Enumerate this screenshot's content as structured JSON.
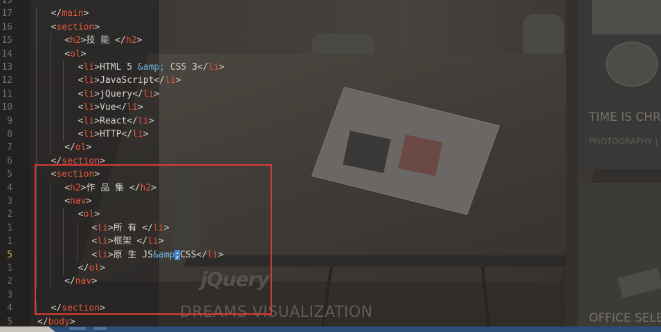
{
  "background": {
    "watermark_logo": "jQuery",
    "center_title": "DREAMS VISUALIZATION",
    "tile_1": {
      "title": "TIME IS CHRO",
      "subtitle": "PHOTOGRAPHY |"
    },
    "tile_2": {
      "title": "OFFICE SELEC"
    }
  },
  "editor": {
    "current_line_number": "5",
    "lines": [
      {
        "num": "19",
        "indent": 0,
        "parts": []
      },
      {
        "num": "17",
        "indent": 1,
        "parts": [
          [
            "p",
            "</"
          ],
          [
            "t",
            "main"
          ],
          [
            "p",
            ">"
          ]
        ]
      },
      {
        "num": "16",
        "indent": 1,
        "parts": [
          [
            "p",
            "<"
          ],
          [
            "t",
            "section"
          ],
          [
            "p",
            ">"
          ]
        ]
      },
      {
        "num": "15",
        "indent": 2,
        "parts": [
          [
            "p",
            "<"
          ],
          [
            "t",
            "h2"
          ],
          [
            "p",
            ">"
          ],
          [
            "p",
            "技 能 "
          ],
          [
            "p",
            "</"
          ],
          [
            "t",
            "h2"
          ],
          [
            "p",
            ">"
          ]
        ]
      },
      {
        "num": "14",
        "indent": 2,
        "parts": [
          [
            "p",
            "<"
          ],
          [
            "t",
            "ol"
          ],
          [
            "p",
            ">"
          ]
        ]
      },
      {
        "num": "13",
        "indent": 3,
        "parts": [
          [
            "p",
            "<"
          ],
          [
            "t",
            "li"
          ],
          [
            "p",
            ">"
          ],
          [
            "p",
            "HTML 5 "
          ],
          [
            "e",
            "&amp;"
          ],
          [
            "p",
            " CSS 3"
          ],
          [
            "p",
            "</"
          ],
          [
            "t",
            "li"
          ],
          [
            "p",
            ">"
          ]
        ]
      },
      {
        "num": "12",
        "indent": 3,
        "parts": [
          [
            "p",
            "<"
          ],
          [
            "t",
            "li"
          ],
          [
            "p",
            ">"
          ],
          [
            "p",
            "JavaScript"
          ],
          [
            "p",
            "</"
          ],
          [
            "t",
            "li"
          ],
          [
            "p",
            ">"
          ]
        ]
      },
      {
        "num": "11",
        "indent": 3,
        "parts": [
          [
            "p",
            "<"
          ],
          [
            "t",
            "li"
          ],
          [
            "p",
            ">"
          ],
          [
            "p",
            "jQuery"
          ],
          [
            "p",
            "</"
          ],
          [
            "t",
            "li"
          ],
          [
            "p",
            ">"
          ]
        ]
      },
      {
        "num": "10",
        "indent": 3,
        "parts": [
          [
            "p",
            "<"
          ],
          [
            "t",
            "li"
          ],
          [
            "p",
            ">"
          ],
          [
            "p",
            "Vue"
          ],
          [
            "p",
            "</"
          ],
          [
            "t",
            "li"
          ],
          [
            "p",
            ">"
          ]
        ]
      },
      {
        "num": "9",
        "indent": 3,
        "parts": [
          [
            "p",
            "<"
          ],
          [
            "t",
            "li"
          ],
          [
            "p",
            ">"
          ],
          [
            "p",
            "React"
          ],
          [
            "p",
            "</"
          ],
          [
            "t",
            "li"
          ],
          [
            "p",
            ">"
          ]
        ]
      },
      {
        "num": "8",
        "indent": 3,
        "parts": [
          [
            "p",
            "<"
          ],
          [
            "t",
            "li"
          ],
          [
            "p",
            ">"
          ],
          [
            "p",
            "HTTP"
          ],
          [
            "p",
            "</"
          ],
          [
            "t",
            "li"
          ],
          [
            "p",
            ">"
          ]
        ]
      },
      {
        "num": "7",
        "indent": 2,
        "parts": [
          [
            "p",
            "</"
          ],
          [
            "t",
            "ol"
          ],
          [
            "p",
            ">"
          ]
        ]
      },
      {
        "num": "6",
        "indent": 1,
        "parts": [
          [
            "p",
            "</"
          ],
          [
            "t",
            "section"
          ],
          [
            "p",
            ">"
          ]
        ]
      },
      {
        "num": "5",
        "indent": 1,
        "parts": [
          [
            "p",
            "<"
          ],
          [
            "t",
            "section"
          ],
          [
            "p",
            ">"
          ]
        ]
      },
      {
        "num": "4",
        "indent": 2,
        "parts": [
          [
            "p",
            "<"
          ],
          [
            "t",
            "h2"
          ],
          [
            "p",
            ">"
          ],
          [
            "p",
            "作 品 集 "
          ],
          [
            "p",
            "</"
          ],
          [
            "t",
            "h2"
          ],
          [
            "p",
            ">"
          ]
        ]
      },
      {
        "num": "3",
        "indent": 2,
        "parts": [
          [
            "p",
            "<"
          ],
          [
            "t",
            "nav"
          ],
          [
            "p",
            ">"
          ]
        ]
      },
      {
        "num": "2",
        "indent": 3,
        "parts": [
          [
            "p",
            "<"
          ],
          [
            "t",
            "ol"
          ],
          [
            "p",
            ">"
          ]
        ]
      },
      {
        "num": "1",
        "indent": 4,
        "parts": [
          [
            "p",
            "<"
          ],
          [
            "t",
            "li"
          ],
          [
            "p",
            ">"
          ],
          [
            "p",
            "所 有 "
          ],
          [
            "p",
            "</"
          ],
          [
            "t",
            "li"
          ],
          [
            "p",
            ">"
          ]
        ]
      },
      {
        "num": "1",
        "indent": 4,
        "parts": [
          [
            "p",
            "<"
          ],
          [
            "t",
            "li"
          ],
          [
            "p",
            ">"
          ],
          [
            "p",
            "框架 "
          ],
          [
            "p",
            "</"
          ],
          [
            "t",
            "li"
          ],
          [
            "p",
            ">"
          ]
        ]
      },
      {
        "num": "5",
        "indent": 4,
        "current": true,
        "parts": [
          [
            "p",
            "<"
          ],
          [
            "t",
            "li"
          ],
          [
            "p",
            ">"
          ],
          [
            "p",
            "原 生 JS"
          ],
          [
            "e",
            "&amp"
          ],
          [
            "c",
            ";"
          ],
          [
            "p",
            "CSS"
          ],
          [
            "p",
            "</"
          ],
          [
            "t",
            "li"
          ],
          [
            "p",
            ">"
          ]
        ]
      },
      {
        "num": "1",
        "indent": 3,
        "parts": [
          [
            "p",
            "</"
          ],
          [
            "t",
            "ol"
          ],
          [
            "p",
            ">"
          ]
        ]
      },
      {
        "num": "2",
        "indent": 2,
        "parts": [
          [
            "p",
            "</"
          ],
          [
            "t",
            "nav"
          ],
          [
            "p",
            ">"
          ]
        ]
      },
      {
        "num": "3",
        "indent": 0,
        "parts": []
      },
      {
        "num": "4",
        "indent": 1,
        "parts": [
          [
            "p",
            "</"
          ],
          [
            "t",
            "section"
          ],
          [
            "p",
            ">"
          ]
        ]
      },
      {
        "num": "5",
        "indent": 0,
        "parts": [
          [
            "p",
            "</"
          ],
          [
            "t",
            "body"
          ],
          [
            "p",
            ">"
          ]
        ]
      }
    ]
  },
  "colors": {
    "tag": "#e6563b",
    "text": "#d7d4cf",
    "entity": "#6fb3e0",
    "cursor": "#3e86d1",
    "highlight_box": "#dc3b34",
    "statusbar": "#2b4d77"
  }
}
